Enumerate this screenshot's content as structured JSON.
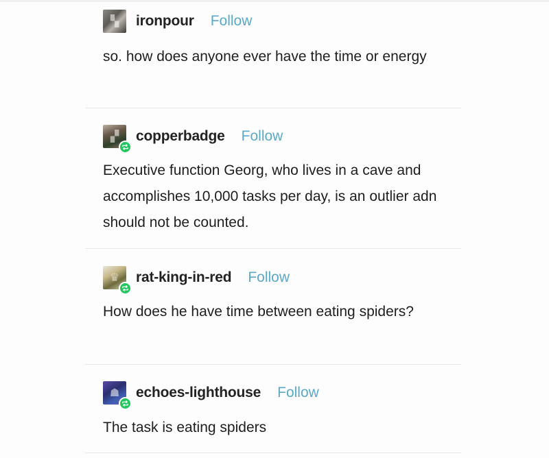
{
  "posts": [
    {
      "username": "ironpour",
      "follow_label": "Follow",
      "avatar_icon": "user-avatar",
      "has_reblog_badge": false,
      "text": "so. how does anyone ever have the time or energy"
    },
    {
      "username": "copperbadge",
      "follow_label": "Follow",
      "avatar_icon": "user-avatar",
      "has_reblog_badge": true,
      "text": "Executive function Georg, who lives in a cave and accomplishes 10,000 tasks per day, is an outlier adn should not be counted."
    },
    {
      "username": "rat-king-in-red",
      "follow_label": "Follow",
      "avatar_icon": "user-avatar",
      "has_reblog_badge": true,
      "text": "How does he have time between eating spiders?"
    },
    {
      "username": "echoes-lighthouse",
      "follow_label": "Follow",
      "avatar_icon": "user-avatar",
      "has_reblog_badge": true,
      "text": "The task is eating spiders"
    }
  ],
  "colors": {
    "follow": "#5ba8c7",
    "reblog_badge": "#22c55e",
    "text": "#1e1e1e",
    "divider": "#e6e6e6"
  }
}
